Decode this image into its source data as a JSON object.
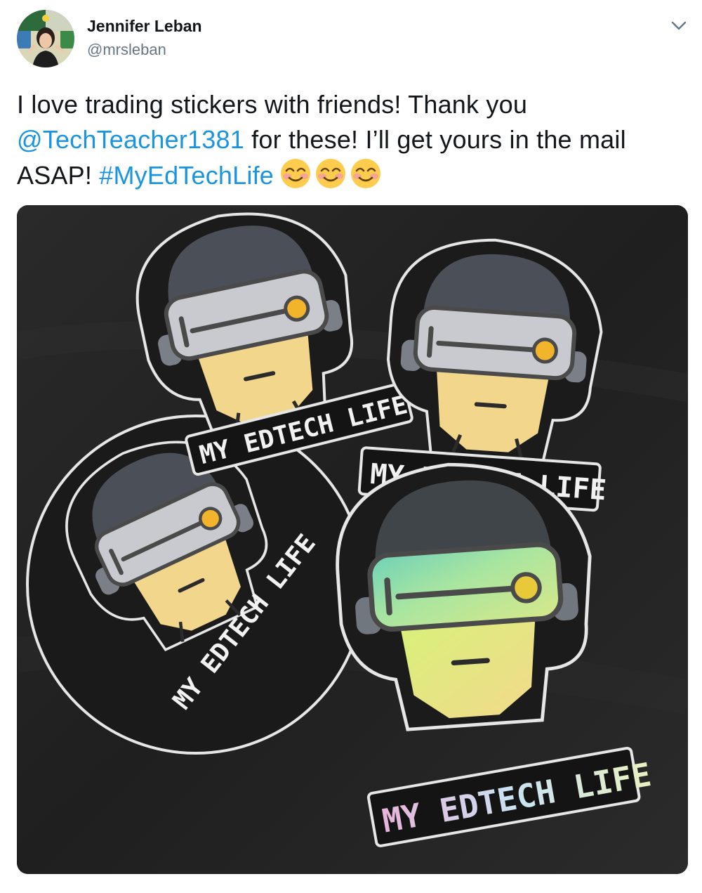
{
  "tweet": {
    "author_name": "Jennifer Leban",
    "author_handle": "@mrsleban",
    "text_part1": "I love trading stickers with friends! Thank you ",
    "mention": "@TechTeacher1381",
    "text_part2": " for these! I’ll get yours in the mail ASAP! ",
    "hashtag": "#MyEdTechLife",
    "emoji_name": "smiling-face-with-smiling-eyes",
    "emoji_count": 3
  },
  "photo": {
    "sticker_label": "MY EDTECH LIFE"
  },
  "colors": {
    "link": "#1b95e0",
    "handle": "#657786",
    "text": "#14171a"
  },
  "icons": {
    "more": "chevron-down-icon",
    "avatar": "profile-avatar"
  }
}
